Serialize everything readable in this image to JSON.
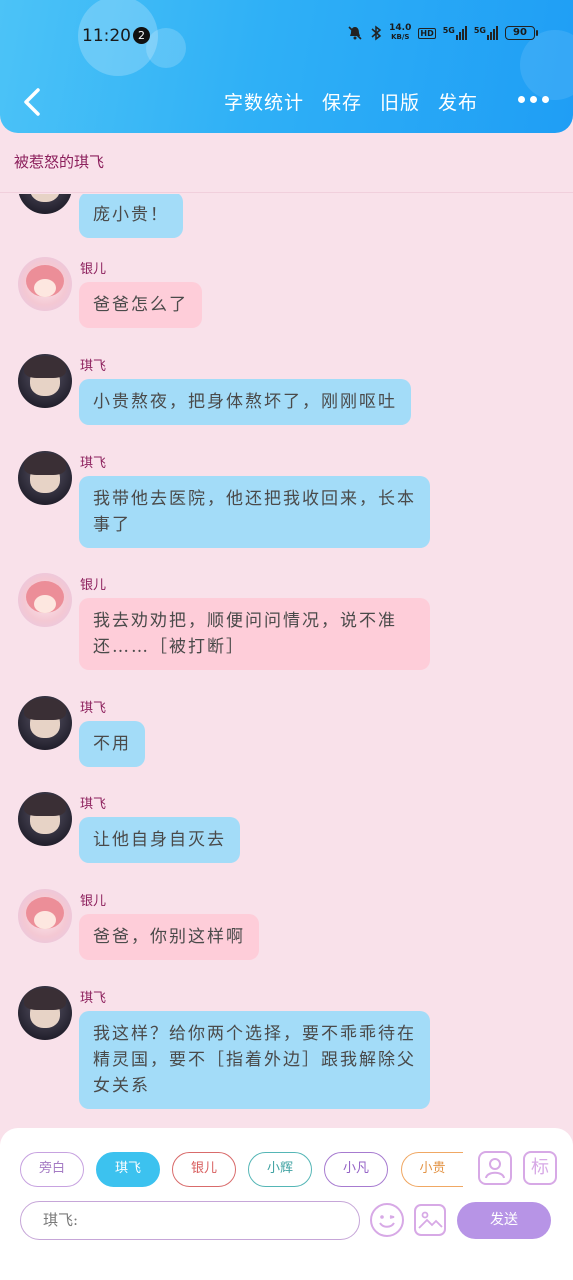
{
  "status_bar": {
    "time": "11:20",
    "notification_count": "2",
    "net_speed_top": "14.0",
    "net_speed_unit": "KB/S",
    "hd_label": "HD",
    "signal_1": "5G",
    "signal_2": "5G",
    "battery": "90"
  },
  "toolbar": {
    "actions": [
      "字数统计",
      "保存",
      "旧版",
      "发布"
    ]
  },
  "story": {
    "title": "被惹怒的琪飞"
  },
  "messages": [
    {
      "speaker": "",
      "avatar": "qifei",
      "bubble": "blue",
      "text": "庞小贵！"
    },
    {
      "speaker": "银儿",
      "avatar": "yiner",
      "bubble": "pink",
      "text": "爸爸怎么了"
    },
    {
      "speaker": "琪飞",
      "avatar": "qifei",
      "bubble": "blue",
      "text": "小贵熬夜，把身体熬坏了，刚刚呕吐"
    },
    {
      "speaker": "琪飞",
      "avatar": "qifei",
      "bubble": "blue",
      "text": "我带他去医院，他还把我收回来，长本事了"
    },
    {
      "speaker": "银儿",
      "avatar": "yiner",
      "bubble": "pink",
      "text": "我去劝劝把，顺便问问情况，说不准还……［被打断］"
    },
    {
      "speaker": "琪飞",
      "avatar": "qifei",
      "bubble": "blue",
      "text": "不用"
    },
    {
      "speaker": "琪飞",
      "avatar": "qifei",
      "bubble": "blue",
      "text": "让他自身自灭去"
    },
    {
      "speaker": "银儿",
      "avatar": "yiner",
      "bubble": "pink",
      "text": "爸爸，你别这样啊"
    },
    {
      "speaker": "琪飞",
      "avatar": "qifei",
      "bubble": "blue",
      "text": "我这样？给你两个选择，要不乖乖待在精灵国，要不［指着外边］跟我解除父女关系"
    }
  ],
  "characters": [
    {
      "label": "旁白",
      "color": "#c7a2e0",
      "text_color": "#a57bc4",
      "active": false
    },
    {
      "label": "琪飞",
      "color": "#3cc2ef",
      "text_color": "#ffffff",
      "active": true
    },
    {
      "label": "银儿",
      "color": "#d96b6b",
      "text_color": "#d85e5e",
      "active": false
    },
    {
      "label": "小辉",
      "color": "#55b6b6",
      "text_color": "#3fa2a2",
      "active": false
    },
    {
      "label": "小凡",
      "color": "#a77bd0",
      "text_color": "#9462c6",
      "active": false
    },
    {
      "label": "小贵",
      "color": "#f0a864",
      "text_color": "#e39446",
      "active": false
    }
  ],
  "composer": {
    "input_value": "琪飞:",
    "send_label": "发送",
    "tag_icon_label": "标"
  }
}
